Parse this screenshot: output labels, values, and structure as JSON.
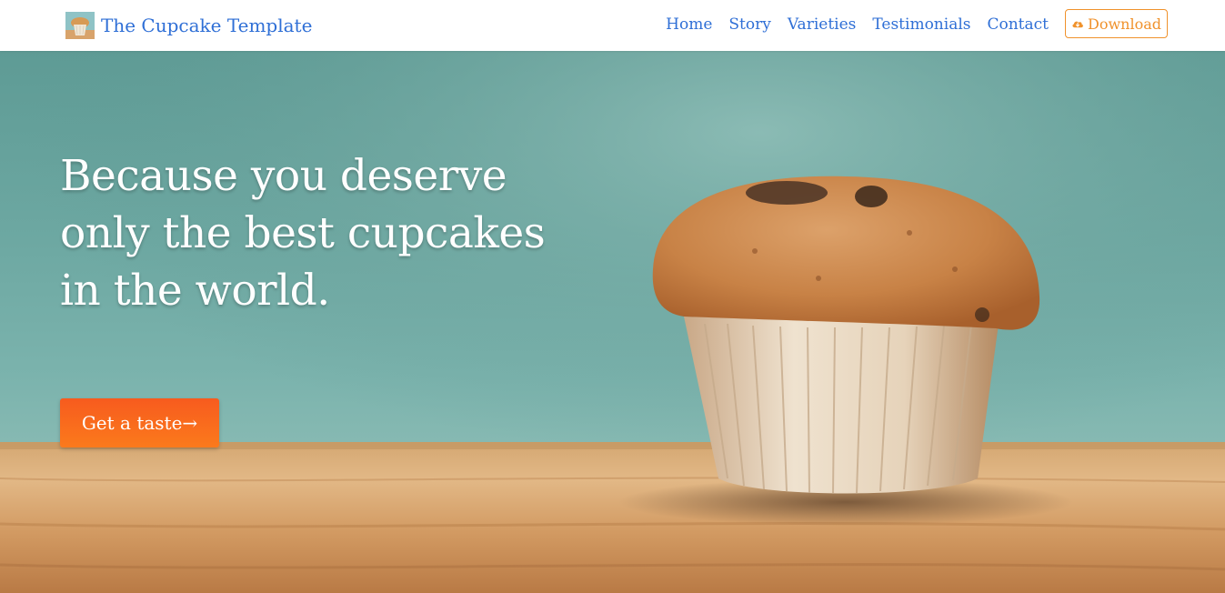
{
  "navbar": {
    "brand_name": "The Cupcake Template",
    "brand_logo_icon": "cupcake-logo-icon",
    "links": [
      {
        "label": "Home"
      },
      {
        "label": "Story"
      },
      {
        "label": "Varieties"
      },
      {
        "label": "Testimonials"
      },
      {
        "label": "Contact"
      }
    ],
    "download": {
      "label": "Download",
      "icon": "cloud-download-icon"
    },
    "link_color": "#2f6fd6",
    "accent_color": "#f0922c"
  },
  "hero": {
    "headline": "Because you deserve only the best cupcakes in the world.",
    "cta_label": "Get a taste→",
    "cta_color": "#f96a1d",
    "background_image": "muffin-on-wooden-table-photo"
  }
}
